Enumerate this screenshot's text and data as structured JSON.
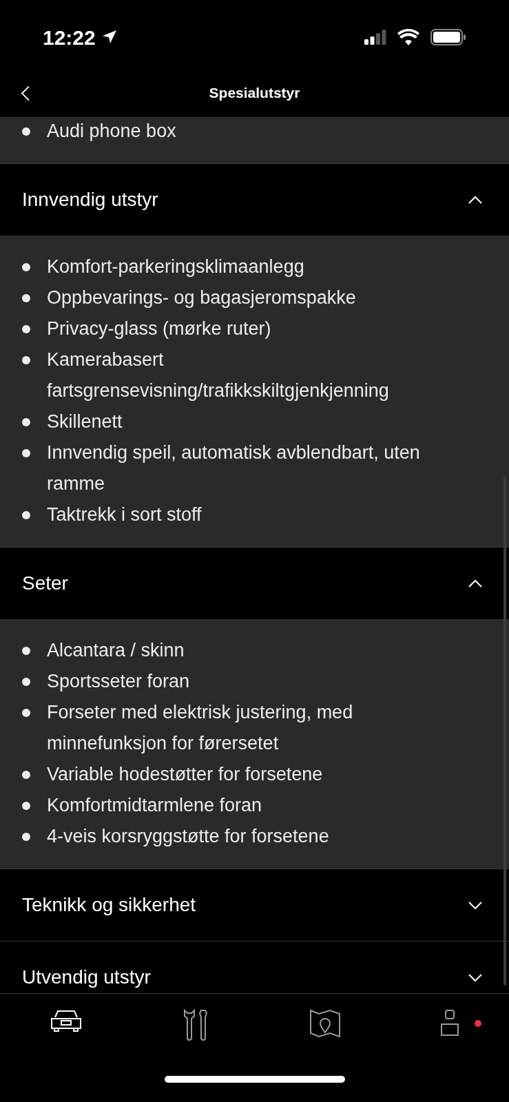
{
  "status_bar": {
    "time": "12:22"
  },
  "nav": {
    "title": "Spesialutstyr"
  },
  "partial_list": {
    "items": [
      "Audi phone box"
    ]
  },
  "sections": [
    {
      "title": "Innvendig utstyr",
      "expanded": true,
      "items": [
        "Komfort-parkeringsklimaanlegg",
        "Oppbevarings- og bagasjeromspakke",
        "Privacy-glass (mørke ruter)",
        "Kamerabasert fartsgrensevisning/trafikkskiltgjenkjenning",
        "Skillenett",
        "Innvendig speil, automatisk avblendbart, uten ramme",
        "Taktrekk i sort stoff"
      ]
    },
    {
      "title": "Seter",
      "expanded": true,
      "items": [
        "Alcantara / skinn",
        "Sportsseter foran",
        "Forseter med elektrisk justering, med minnefunksjon for førersetet",
        "Variable hodestøtter for forsetene",
        "Komfortmidtarmlene foran",
        "4-veis korsryggstøtte for forsetene"
      ]
    },
    {
      "title": "Teknikk og sikkerhet",
      "expanded": false
    },
    {
      "title": "Utvendig utstyr",
      "expanded": false
    }
  ],
  "tab_bar": [
    {
      "kind": "car",
      "selected": true
    },
    {
      "kind": "tools",
      "selected": false
    },
    {
      "kind": "map",
      "selected": false
    },
    {
      "kind": "profile",
      "selected": false,
      "notification": true
    }
  ]
}
